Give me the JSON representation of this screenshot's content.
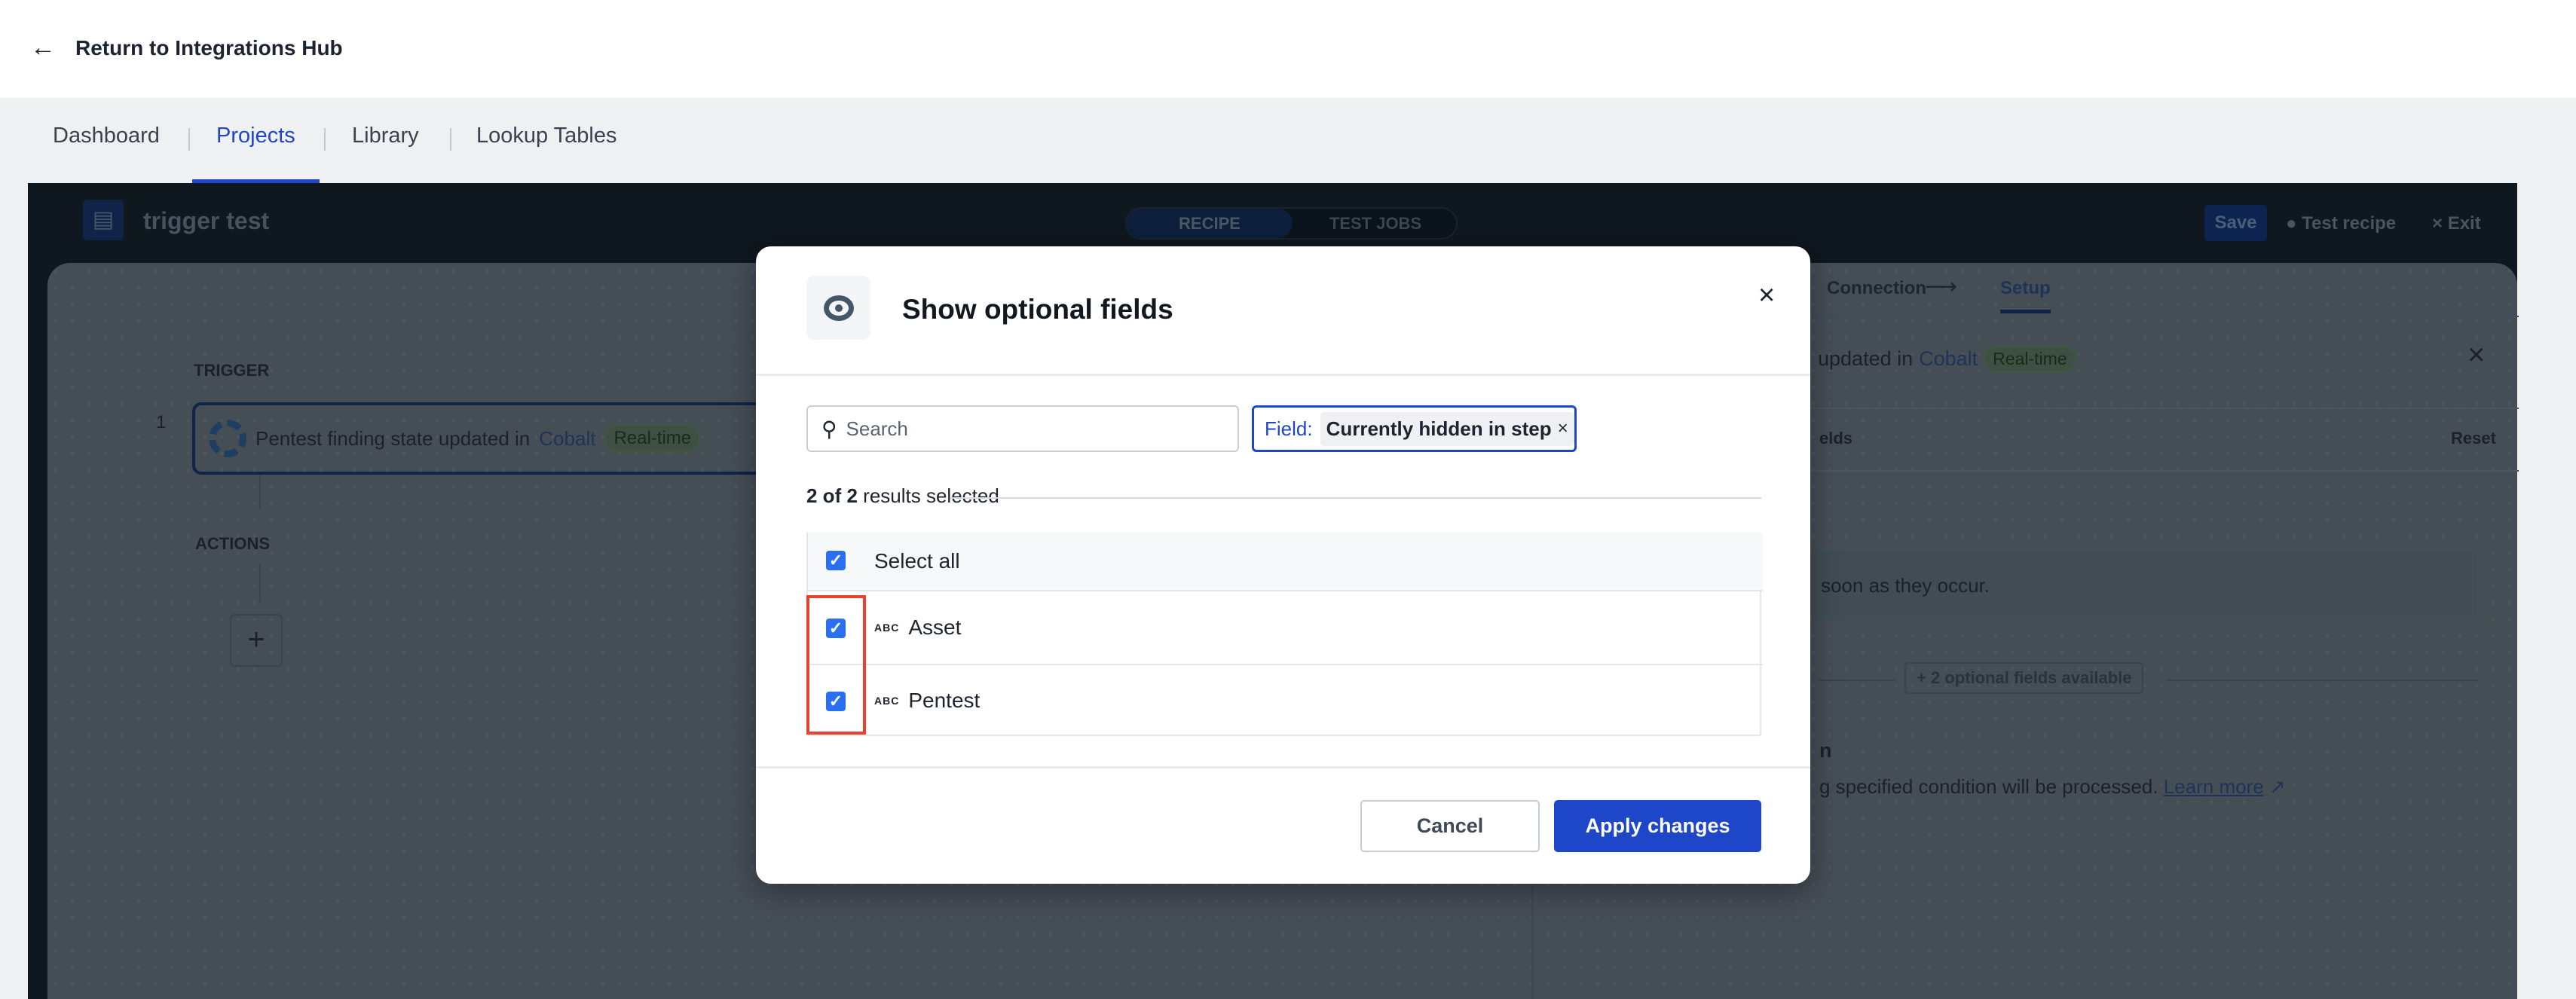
{
  "topbar": {
    "back_label": "Return to Integrations Hub"
  },
  "nav_tabs": [
    {
      "label": "Dashboard"
    },
    {
      "label": "Projects",
      "active": true
    },
    {
      "label": "Library"
    },
    {
      "label": "Lookup Tables"
    }
  ],
  "recipe": {
    "title": "trigger test",
    "toggle": {
      "recipe": "RECIPE",
      "test_jobs": "TEST JOBS",
      "selected": "RECIPE"
    },
    "save": "Save",
    "test_recipe": "Test recipe",
    "exit": "Exit",
    "trigger_heading": "TRIGGER",
    "actions_heading": "ACTIONS",
    "step_number": "1",
    "trigger_text": "Pentest finding state updated in",
    "trigger_app": "Cobalt",
    "trigger_badge": "Real-time",
    "add_action": "+"
  },
  "side_panel": {
    "tabs": {
      "connection": "Connection",
      "setup": "Setup"
    },
    "title_fragment": "updated in",
    "app": "Cobalt",
    "badge": "Real-time",
    "fields_fragment": "elds",
    "reset": "Reset",
    "info_fragment": "soon as they occur.",
    "optional_button": "+ 2 optional fields available",
    "heading_fragment": "n",
    "desc_fragment": "g specified condition will be processed.",
    "learn_more": "Learn more"
  },
  "modal": {
    "title": "Show optional fields",
    "search_placeholder": "Search",
    "filter_label": "Field:",
    "filter_value": "Currently hidden in step",
    "results_count": "2 of 2",
    "results_suffix": "results selected",
    "select_all": "Select all",
    "fields": [
      {
        "type": "ABC",
        "label": "Asset",
        "checked": true
      },
      {
        "type": "ABC",
        "label": "Pentest",
        "checked": true
      }
    ],
    "cancel": "Cancel",
    "apply": "Apply changes"
  },
  "colors": {
    "primary": "#1d46c8",
    "checkbox": "#2a6ff0",
    "highlight": "#e8432e"
  }
}
